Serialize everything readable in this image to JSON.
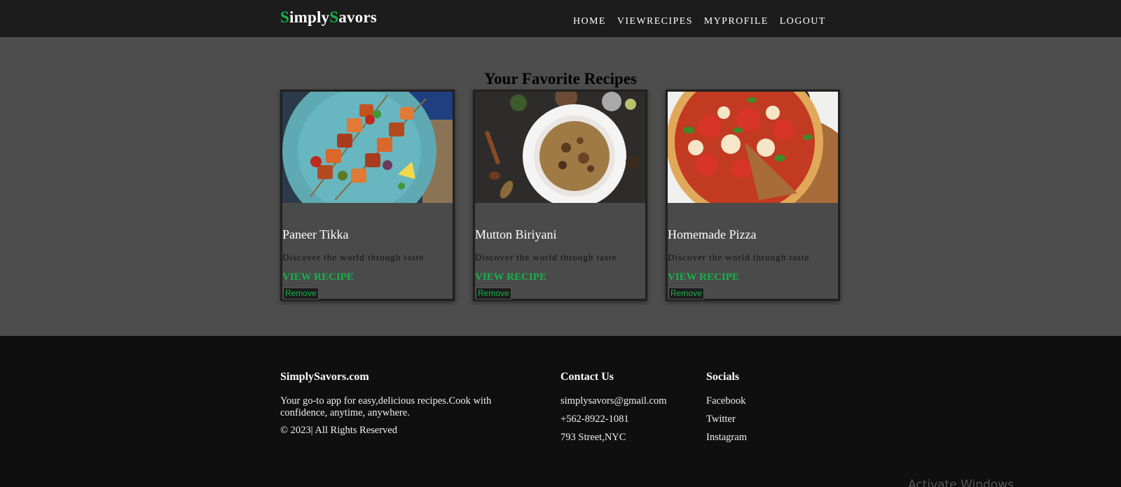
{
  "brand": {
    "logo_parts": [
      {
        "text": "S",
        "accent": true
      },
      {
        "text": "imply",
        "accent": false
      },
      {
        "text": "S",
        "accent": true
      },
      {
        "text": "avors",
        "accent": false
      }
    ],
    "accent_color": "#16b34a"
  },
  "nav": {
    "items": [
      "HOME",
      "VIEWRECIPES",
      "MYPROFILE",
      "LOGOUT"
    ]
  },
  "main": {
    "title": "Your Favorite Recipes",
    "cards": [
      {
        "title": "Paneer Tikka",
        "description": "Discover the world through taste",
        "link_label": "VIEW RECIPE",
        "remove_label": "Remove",
        "image": "paneer-tikka-skewers-photo"
      },
      {
        "title": "Mutton Biriyani",
        "description": "Discover the world through taste",
        "link_label": "VIEW RECIPE",
        "remove_label": "Remove",
        "image": "mutton-biriyani-plate-photo"
      },
      {
        "title": "Homemade Pizza",
        "description": "Discover the world through taste",
        "link_label": "VIEW RECIPE",
        "remove_label": "Remove",
        "image": "homemade-pizza-photo"
      }
    ]
  },
  "footer": {
    "about": {
      "heading": "SimplySavors.com",
      "description": "Your go-to app for easy,delicious recipes.Cook with confidence, anytime, anywhere.",
      "copyright": "© 2023| All Rights Reserved"
    },
    "contact": {
      "heading": "Contact Us",
      "email": "simplysavors@gmail.com",
      "phone": "+562-8922-1081",
      "address": "793 Street,NYC"
    },
    "socials": {
      "heading": "Socials",
      "links": [
        "Facebook",
        "Twitter",
        "Instagram"
      ]
    }
  },
  "system": {
    "watermark": "Activate Windows"
  }
}
